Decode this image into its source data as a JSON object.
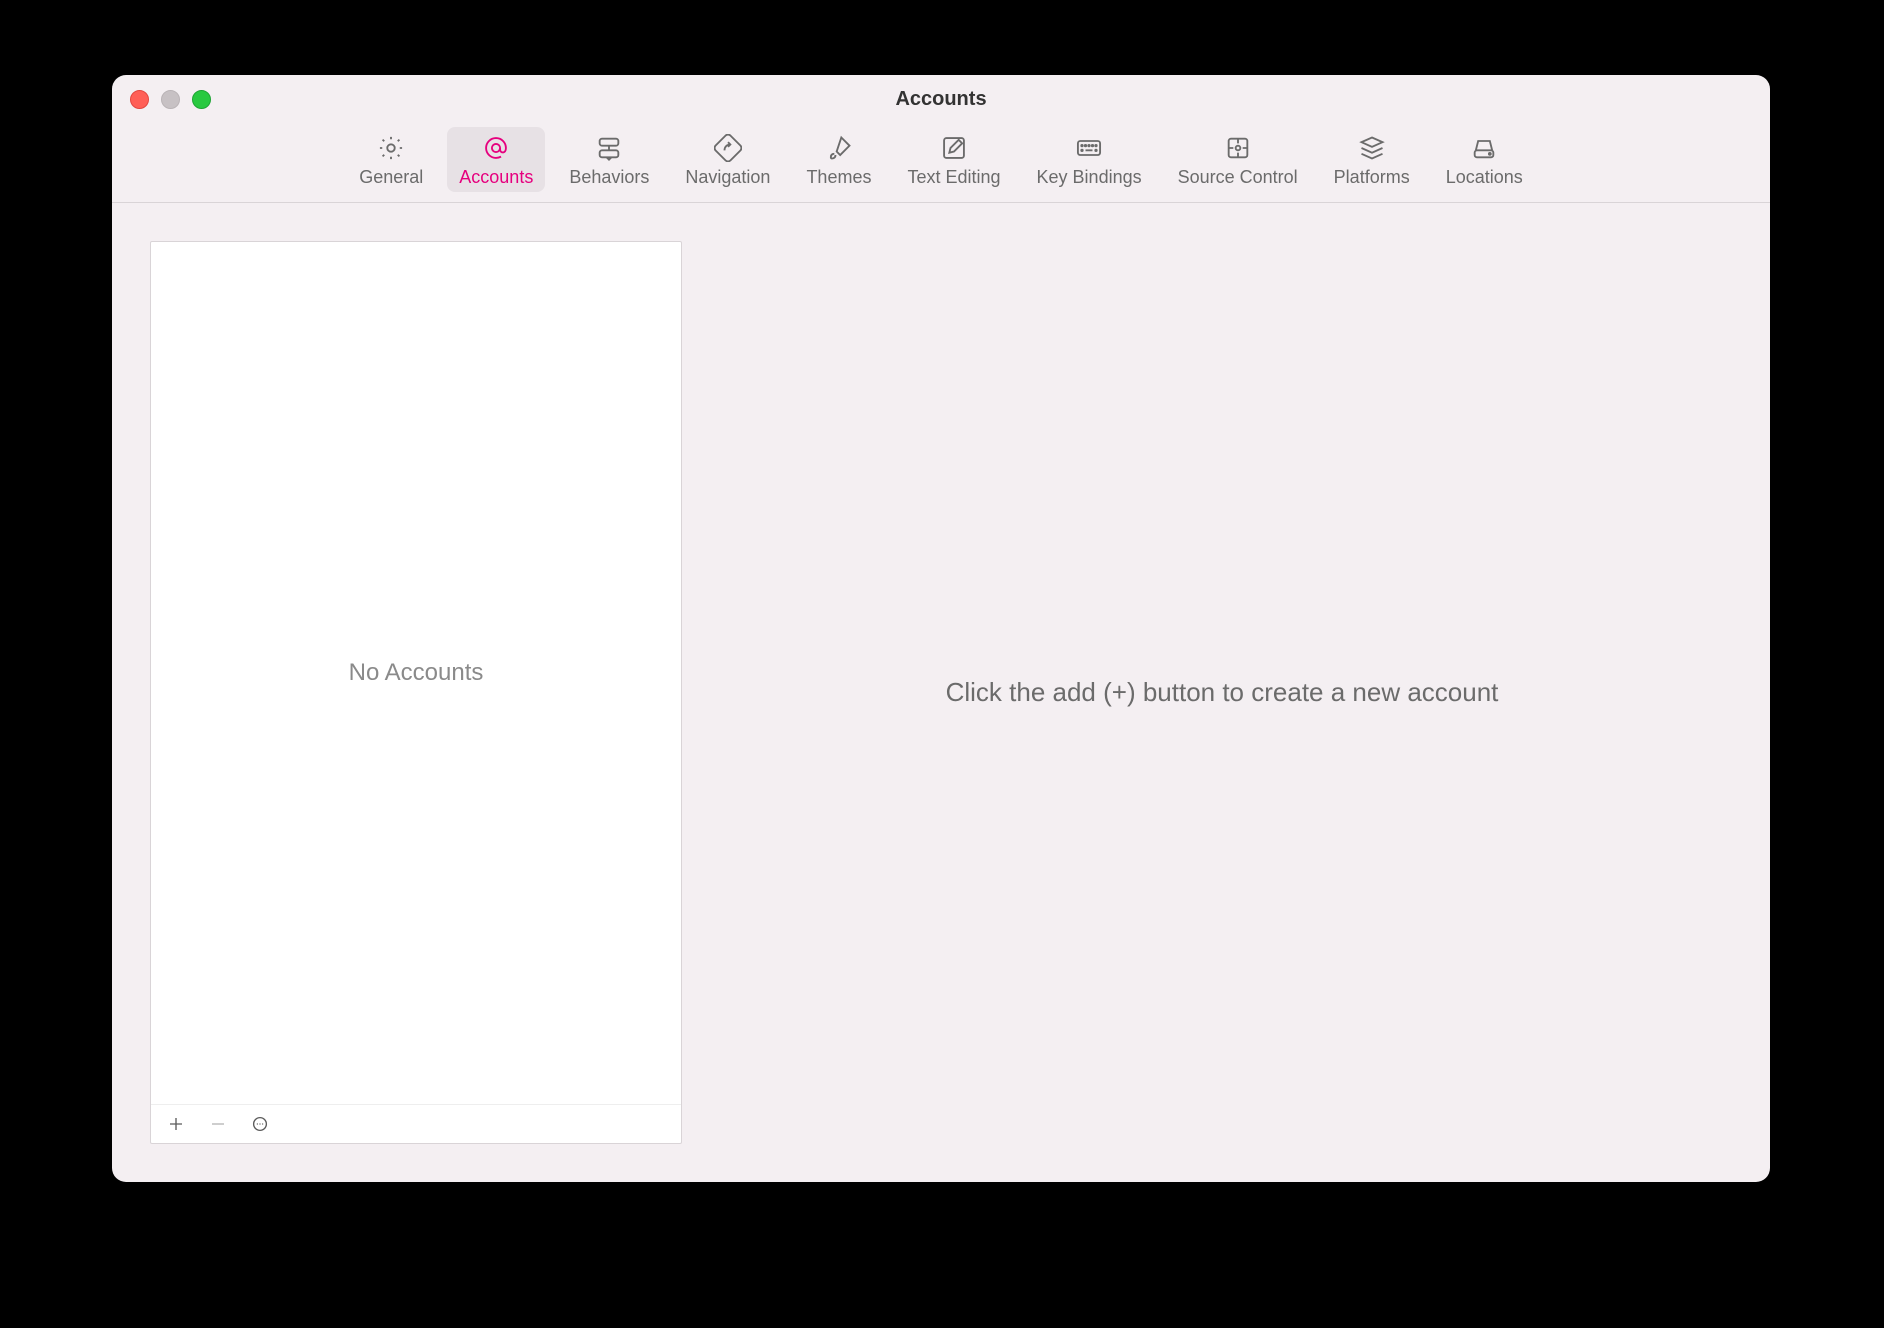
{
  "window": {
    "title": "Accounts"
  },
  "tabs": {
    "general": {
      "label": "General"
    },
    "accounts": {
      "label": "Accounts"
    },
    "behaviors": {
      "label": "Behaviors"
    },
    "navigation": {
      "label": "Navigation"
    },
    "themes": {
      "label": "Themes"
    },
    "text_editing": {
      "label": "Text Editing"
    },
    "key_bindings": {
      "label": "Key Bindings"
    },
    "source_control": {
      "label": "Source Control"
    },
    "platforms": {
      "label": "Platforms"
    },
    "locations": {
      "label": "Locations"
    }
  },
  "sidebar": {
    "empty_label": "No Accounts"
  },
  "detail": {
    "hint": "Click the add (+) button to create a new account"
  }
}
